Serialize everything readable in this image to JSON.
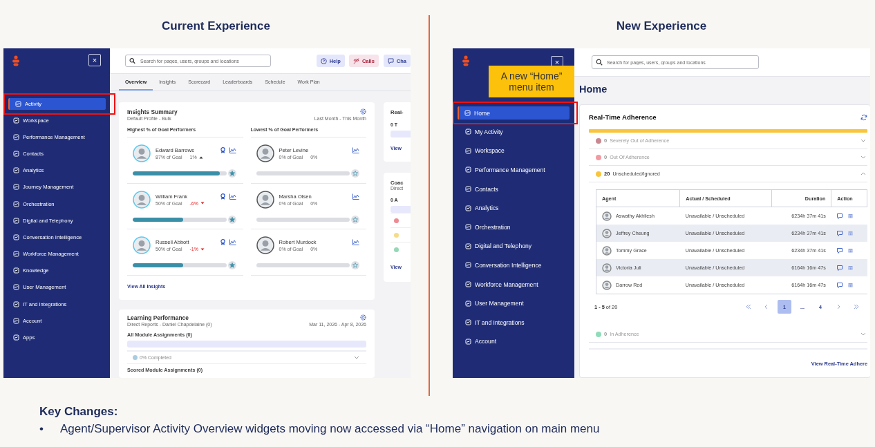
{
  "current_experience": {
    "heading": "Current Experience",
    "sidebar": {
      "close": "×",
      "items": [
        {
          "label": "Activity",
          "selected": true
        },
        {
          "label": "Workspace",
          "selected": false
        },
        {
          "label": "Performance Management",
          "selected": false
        },
        {
          "label": "Contacts",
          "selected": false
        },
        {
          "label": "Analytics",
          "selected": false
        },
        {
          "label": "Journey Management",
          "selected": false
        },
        {
          "label": "Orchestration",
          "selected": false
        },
        {
          "label": "Digital and Telephony",
          "selected": false
        },
        {
          "label": "Conversation Intelligence",
          "selected": false
        },
        {
          "label": "Workforce Management",
          "selected": false
        },
        {
          "label": "Knowledge",
          "selected": false
        },
        {
          "label": "User Management",
          "selected": false
        },
        {
          "label": "IT and Integrations",
          "selected": false
        },
        {
          "label": "Account",
          "selected": false
        },
        {
          "label": "Apps",
          "selected": false
        }
      ]
    },
    "search": {
      "placeholder": "Search for pages, users, groups and locations"
    },
    "header_buttons": [
      {
        "label": "Help",
        "kind": "help"
      },
      {
        "label": "Calls",
        "kind": "calls"
      },
      {
        "label": "Cha",
        "kind": "chat"
      }
    ],
    "tabs": [
      {
        "label": "Overview",
        "selected": true
      },
      {
        "label": "Insights",
        "selected": false
      },
      {
        "label": "Scorecard",
        "selected": false
      },
      {
        "label": "Leaderboards",
        "selected": false
      },
      {
        "label": "Schedule",
        "selected": false
      },
      {
        "label": "Work Plan",
        "selected": false
      }
    ],
    "insights": {
      "title": "Insights Summary",
      "subtitle": "Default Profile - Bulk",
      "date_range": "Last Month - This Month",
      "columns": [
        {
          "heading": "Highest % of Goal Performers",
          "kind": "highest",
          "performers": [
            {
              "name": "Edward Barrows",
              "goal": "87% of Goal",
              "change": "1%",
              "rising": true,
              "falling": false,
              "badge": true,
              "level": 0.93
            },
            {
              "name": "William Frank",
              "goal": "50% of Goal",
              "change": "-6%",
              "rising": false,
              "falling": true,
              "badge": true,
              "level": 0.54
            },
            {
              "name": "Russell Abbott",
              "goal": "50% of Goal",
              "change": "-1%",
              "rising": false,
              "falling": true,
              "badge": true,
              "level": 0.54
            }
          ]
        },
        {
          "heading": "Lowest % of Goal Performers",
          "kind": "lowest",
          "performers": [
            {
              "name": "Peter Levine",
              "goal": "0% of Goal",
              "change": "0%",
              "rising": false,
              "falling": false,
              "badge": false
            },
            {
              "name": "Marsha Olsen",
              "goal": "0% of Goal",
              "change": "0%",
              "rising": false,
              "falling": false,
              "badge": false
            },
            {
              "name": "Robert Murdock",
              "goal": "0% of Goal",
              "change": "0%",
              "rising": false,
              "falling": false,
              "badge": false
            }
          ]
        }
      ],
      "link": "View All Insights"
    },
    "learning": {
      "title": "Learning Performance",
      "subtitle": "Direct Reports - Daniel Chapdelaine (0)",
      "date_range": "Mar 11, 2026 - Apr 8, 2026",
      "section": "All Module Assignments (0)",
      "status": "0% Completed",
      "next_section": "Scored Module Assignments (0)"
    },
    "side_cards": [
      {
        "title": "Real-",
        "count": "0 T",
        "link": "View"
      },
      {
        "title": "Coac",
        "subtitle": "Direct",
        "count": "0 A",
        "dots": [
          {
            "color": "#ee8a92"
          },
          {
            "color": "#f6dc86"
          },
          {
            "color": "#94d8b6"
          }
        ],
        "link": "View"
      }
    ]
  },
  "new_experience": {
    "heading": "New Experience",
    "callout": "A new “Home” menu item",
    "sidebar": {
      "close": "×",
      "items": [
        {
          "label": "Home",
          "selected": true
        },
        {
          "label": "My Activity",
          "selected": false
        },
        {
          "label": "Workspace",
          "selected": false
        },
        {
          "label": "Performance Management",
          "selected": false
        },
        {
          "label": "Contacts",
          "selected": false
        },
        {
          "label": "Analytics",
          "selected": false
        },
        {
          "label": "Orchestration",
          "selected": false
        },
        {
          "label": "Digital and Telephony",
          "selected": false
        },
        {
          "label": "Conversation Intelligence",
          "selected": false
        },
        {
          "label": "Workforce Management",
          "selected": false
        },
        {
          "label": "User Management",
          "selected": false
        },
        {
          "label": "IT and Integrations",
          "selected": false
        },
        {
          "label": "Account",
          "selected": false
        }
      ]
    },
    "search": {
      "placeholder": "Search for pages, users, groups and locations"
    },
    "page_title": "Home",
    "adherence": {
      "title": "Real-Time Adherence",
      "level": 1,
      "groups": [
        {
          "count": "0",
          "label": "Severely Out of Adherence",
          "color": "#c98891",
          "muted": true,
          "expanded": false
        },
        {
          "count": "0",
          "label": "Out Of Adherence",
          "color": "#f29aa3",
          "muted": true,
          "expanded": false
        },
        {
          "count": "20",
          "label": "Unscheduled/Ignored",
          "color": "#f8c53c",
          "muted": false,
          "expanded": true,
          "table": {
            "columns": [
              "Agent",
              "Actual / Scheduled",
              "Duration",
              "Action"
            ],
            "rows": [
              {
                "agent": "Aswathy Akhilesh",
                "status": "Unavailable / Unscheduled",
                "duration": "6234h 37m 41s"
              },
              {
                "agent": "Jeffrey Cheung",
                "status": "Unavailable / Unscheduled",
                "duration": "6234h 37m 41s"
              },
              {
                "agent": "Tommy Grace",
                "status": "Unavailable / Unscheduled",
                "duration": "6234h 37m 41s"
              },
              {
                "agent": "Victoria Juli",
                "status": "Unavailable / Unscheduled",
                "duration": "6164h 16m 47s"
              },
              {
                "agent": "Darrow Red",
                "status": "Unavailable / Unscheduled",
                "duration": "6164h 16m 47s"
              }
            ]
          },
          "range": "**1 - 5** of 20",
          "pages": [
            {
              "label": "1",
              "selected": true
            },
            {
              "label": "...",
              "selected": false
            },
            {
              "label": "4",
              "selected": false
            }
          ]
        },
        {
          "count": "0",
          "label": "In Adherence",
          "color": "#8fdcb8",
          "muted": true,
          "expanded": false
        }
      ],
      "link": "View Real-Time Adhere"
    }
  },
  "key_changes": {
    "title": "Key Changes:",
    "bullets": [
      {
        "marker": "•",
        "text": "Agent/Supervisor Activity Overview widgets moving now accessed via “Home” navigation on main menu"
      }
    ]
  }
}
